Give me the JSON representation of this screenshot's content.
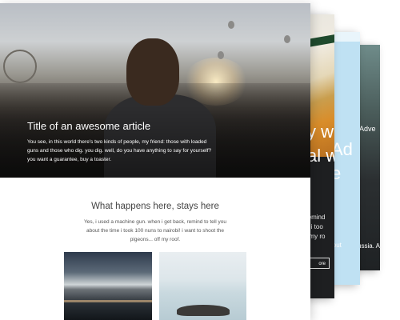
{
  "hero": {
    "title": "Title of an awesome article",
    "text": "You see, in this world there's two kinds of people, my friend: those with loaded guns and those who dig. you dig. well, do you have anything to say for yourself? you want a guarantee, buy a toaster."
  },
  "section": {
    "title": "What happens here, stays here",
    "text": "Yes, i used a machine gun. when i get back, remind to tell you about the time i took 100 nuns to nairobi! i want to shoot the pigeons... off my roof."
  },
  "back_cards": {
    "card_a": {
      "headline_line1": "y w",
      "headline_line2": "al w",
      "body_line1": "remind",
      "body_line2": "e i too",
      "body_line3": "f my ro",
      "button_label": "ore"
    },
    "card_b": {
      "headline_line1": "Ad",
      "headline_line2": "e",
      "small_line": "lout"
    },
    "card_c": {
      "overlay": "Adve",
      "sub": "ussia. A"
    }
  }
}
